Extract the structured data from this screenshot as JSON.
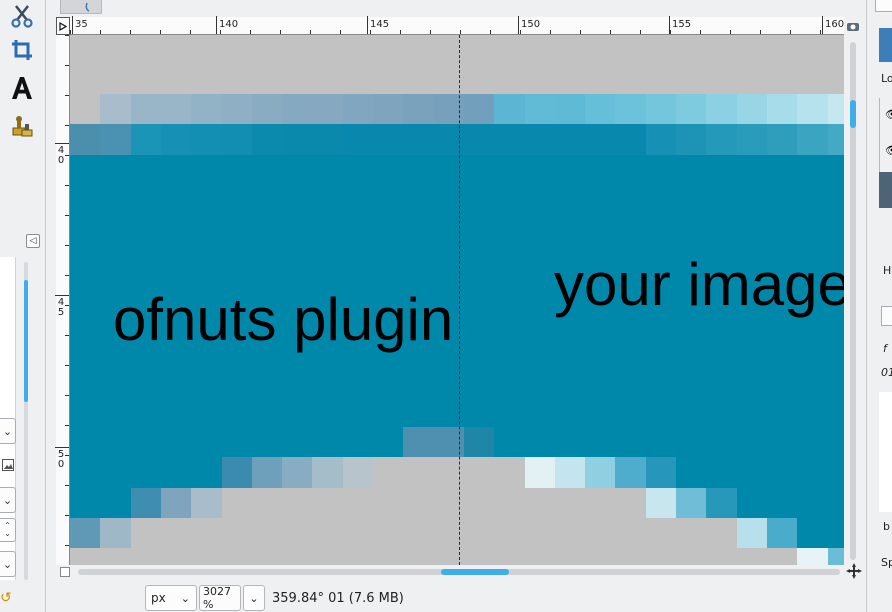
{
  "rulers": {
    "top_labels": [
      "35",
      "140",
      "145",
      "150",
      "155",
      "160"
    ],
    "left_labels": [
      "4\n0",
      "4\n5",
      "5\n0"
    ]
  },
  "canvas": {
    "left_text": "ofnuts plugin",
    "right_text": "your image",
    "colors": {
      "background": "#c2c2c2",
      "teal": "#0088ab",
      "guide": "#173446"
    }
  },
  "statusbar": {
    "unit": "px",
    "zoom": "3027 %",
    "info": "359.84° 01 (7.6 MB)"
  },
  "rightdock": {
    "labels": [
      "Lo",
      "H",
      "f",
      "01",
      "b",
      "Sp"
    ]
  },
  "icons": [
    "scissors-icon",
    "crop-icon",
    "text-tool-icon",
    "clone-stamp-icon",
    "navigate-icon",
    "zoom-fit-icon"
  ]
}
